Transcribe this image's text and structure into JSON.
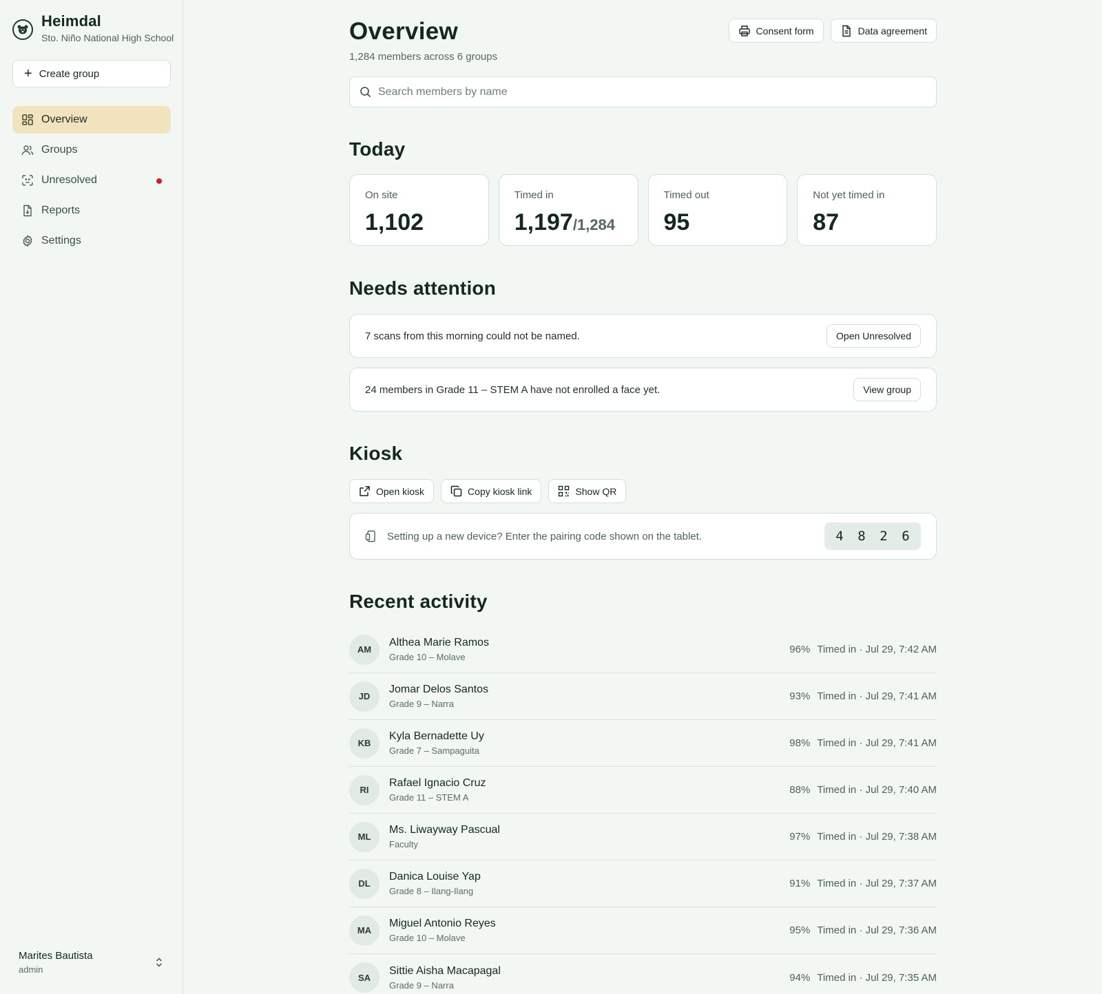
{
  "brand": {
    "name": "Heimdal",
    "school": "Sto. Niño National High School"
  },
  "sidebar": {
    "create_label": "Create group",
    "items": [
      {
        "label": "Overview",
        "icon": "grid-icon",
        "active": true
      },
      {
        "label": "Groups",
        "icon": "users-icon"
      },
      {
        "label": "Unresolved",
        "icon": "face-scan-icon",
        "alert": true
      },
      {
        "label": "Reports",
        "icon": "report-file-icon"
      },
      {
        "label": "Settings",
        "icon": "gear-icon"
      }
    ],
    "user": {
      "name": "Marites Bautista",
      "role": "admin"
    }
  },
  "header": {
    "title": "Overview",
    "subtitle": "1,284 members across 6 groups",
    "consent_label": "Consent form",
    "agreement_label": "Data agreement"
  },
  "search": {
    "placeholder": "Search members by name"
  },
  "today": {
    "title": "Today",
    "stats": [
      {
        "label": "On site",
        "value": "1,102"
      },
      {
        "label": "Timed in",
        "value": "1,197",
        "of": "/1,284"
      },
      {
        "label": "Timed out",
        "value": "95"
      },
      {
        "label": "Not yet timed in",
        "value": "87"
      }
    ]
  },
  "attention": {
    "title": "Needs attention",
    "items": [
      {
        "text": "7 scans from this morning could not be named.",
        "action": "Open Unresolved"
      },
      {
        "text": "24 members in Grade 11 – STEM A have not enrolled a face yet.",
        "action": "View group"
      }
    ]
  },
  "kiosk": {
    "title": "Kiosk",
    "open_label": "Open kiosk",
    "copy_label": "Copy kiosk link",
    "qr_label": "Show QR",
    "pairing_text": "Setting up a new device? Enter the pairing code shown on the tablet.",
    "code": [
      "4",
      "8",
      "2",
      "6"
    ]
  },
  "activity": {
    "title": "Recent activity",
    "rows": [
      {
        "initials": "AM",
        "name": "Althea Marie Ramos",
        "group": "Grade 10 – Molave",
        "pct": "96%",
        "status": "Timed in · Jul 29, 7:42 AM"
      },
      {
        "initials": "JD",
        "name": "Jomar Delos Santos",
        "group": "Grade 9 – Narra",
        "pct": "93%",
        "status": "Timed in · Jul 29, 7:41 AM"
      },
      {
        "initials": "KB",
        "name": "Kyla Bernadette Uy",
        "group": "Grade 7 – Sampaguita",
        "pct": "98%",
        "status": "Timed in · Jul 29, 7:41 AM"
      },
      {
        "initials": "RI",
        "name": "Rafael Ignacio Cruz",
        "group": "Grade 11 – STEM A",
        "pct": "88%",
        "status": "Timed in · Jul 29, 7:40 AM"
      },
      {
        "initials": "ML",
        "name": "Ms. Liwayway Pascual",
        "group": "Faculty",
        "pct": "97%",
        "status": "Timed in · Jul 29, 7:38 AM"
      },
      {
        "initials": "DL",
        "name": "Danica Louise Yap",
        "group": "Grade 8 – Ilang-Ilang",
        "pct": "91%",
        "status": "Timed in · Jul 29, 7:37 AM"
      },
      {
        "initials": "MA",
        "name": "Miguel Antonio Reyes",
        "group": "Grade 10 – Molave",
        "pct": "95%",
        "status": "Timed in · Jul 29, 7:36 AM"
      },
      {
        "initials": "SA",
        "name": "Sittie Aisha Macapagal",
        "group": "Grade 9 – Narra",
        "pct": "94%",
        "status": "Timed in · Jul 29, 7:35 AM"
      }
    ]
  }
}
